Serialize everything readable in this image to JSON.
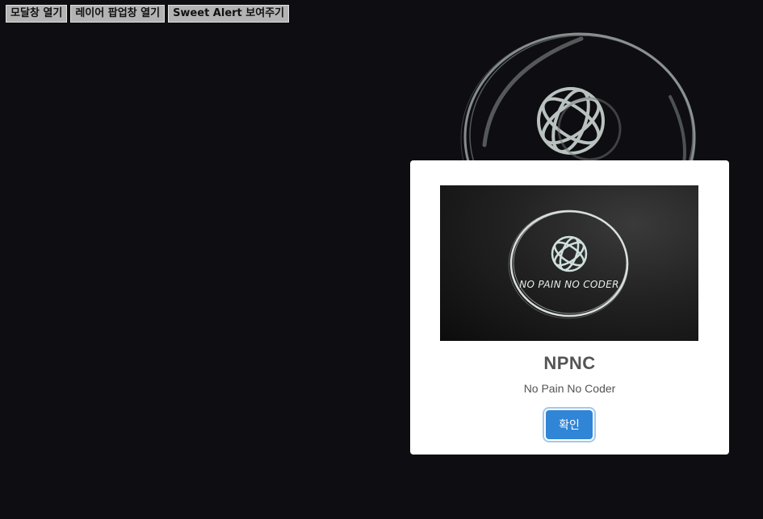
{
  "toolbar": {
    "buttons": [
      {
        "label": "모달창 열기"
      },
      {
        "label": "레이어 팝업창 열기"
      },
      {
        "label": "Sweet Alert 보여주기"
      }
    ]
  },
  "alert": {
    "image_caption": "NO PAIN NO CODER",
    "title": "NPNC",
    "text": "No Pain No Coder",
    "confirm_label": "확인"
  },
  "colors": {
    "background": "#0e0d11",
    "confirm_button": "#3085d6",
    "logo_stroke": "#cfd8d5"
  }
}
